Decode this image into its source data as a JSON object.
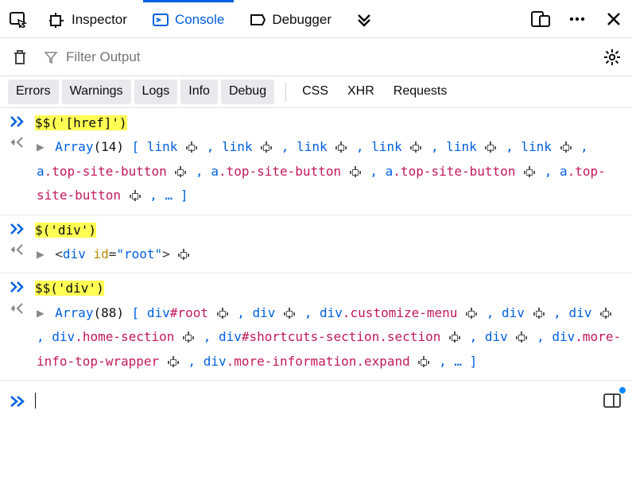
{
  "tabs": {
    "inspector": "Inspector",
    "console": "Console",
    "debugger": "Debugger"
  },
  "activeTab": "console",
  "filter": {
    "placeholder": "Filter Output"
  },
  "categories": {
    "errors": "Errors",
    "warnings": "Warnings",
    "logs": "Logs",
    "info": "Info",
    "debug": "Debug",
    "css": "CSS",
    "xhr": "XHR",
    "requests": "Requests"
  },
  "entries": [
    {
      "input": "$$('[href]')",
      "highlighted": true,
      "output": {
        "kind": "array",
        "length": 14,
        "items": [
          {
            "tag": "link",
            "class": ""
          },
          {
            "tag": "link",
            "class": ""
          },
          {
            "tag": "link",
            "class": ""
          },
          {
            "tag": "link",
            "class": ""
          },
          {
            "tag": "link",
            "class": ""
          },
          {
            "tag": "link",
            "class": ""
          },
          {
            "tag": "a",
            "class": "top-site-button"
          },
          {
            "tag": "a",
            "class": "top-site-button"
          },
          {
            "tag": "a",
            "class": "top-site-button"
          },
          {
            "tag": "a",
            "class": "top-site-button"
          }
        ],
        "truncated": true
      }
    },
    {
      "input": "$('div')",
      "highlighted": true,
      "output": {
        "kind": "node",
        "html": {
          "tag": "div",
          "attr": "id",
          "val": "root"
        }
      }
    },
    {
      "input": "$$('div')",
      "highlighted": true,
      "output": {
        "kind": "array",
        "length": 88,
        "items": [
          {
            "tag": "div",
            "class": "",
            "id": "root"
          },
          {
            "tag": "div",
            "class": ""
          },
          {
            "tag": "div",
            "class": "customize-menu"
          },
          {
            "tag": "div",
            "class": ""
          },
          {
            "tag": "div",
            "class": ""
          },
          {
            "tag": "div",
            "class": "home-section"
          },
          {
            "tag": "div",
            "class": "section",
            "id": "shortcuts-section"
          },
          {
            "tag": "div",
            "class": ""
          },
          {
            "tag": "div",
            "class": "more-info-top-wrapper"
          },
          {
            "tag": "div",
            "class": "more-information.expand"
          }
        ],
        "truncated": true
      }
    }
  ]
}
